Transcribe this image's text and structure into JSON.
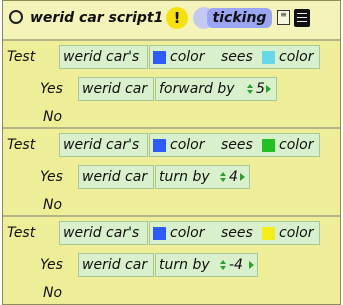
{
  "title": "werid car script1",
  "status_label": "ticking",
  "icons": {
    "close": "circle-icon",
    "warning": "exclamation-icon",
    "clock": "clock-icon",
    "properties": "properties-icon",
    "menu": "menu-icon"
  },
  "colors": {
    "window_bg": "#eeee99",
    "tile_bg": "#d8f0cc",
    "status_bg": "#9aa6f3",
    "warning_yellow": "#f7e10c",
    "blue": "#2e5bff",
    "light_blue": "#67d7ea",
    "green": "#22c022",
    "yellow": "#f3ee17"
  },
  "tests": [
    {
      "test_label": "Test",
      "object": "werid car's",
      "attribute": "color",
      "sees": "sees",
      "target_color": "color",
      "own_color": "#2e5bff",
      "seen_color": "#67d7ea",
      "yes_label": "Yes",
      "action_object": "werid car",
      "action": "forward by",
      "value": "5",
      "no_label": "No"
    },
    {
      "test_label": "Test",
      "object": "werid car's",
      "attribute": "color",
      "sees": "sees",
      "target_color": "color",
      "own_color": "#2e5bff",
      "seen_color": "#22c022",
      "yes_label": "Yes",
      "action_object": "werid car",
      "action": "turn by",
      "value": "4",
      "no_label": "No"
    },
    {
      "test_label": "Test",
      "object": "werid car's",
      "attribute": "color",
      "sees": "sees",
      "target_color": "color",
      "own_color": "#2e5bff",
      "seen_color": "#f3ee17",
      "yes_label": "Yes",
      "action_object": "werid car",
      "action": "turn by",
      "value": "-4",
      "no_label": "No"
    }
  ]
}
